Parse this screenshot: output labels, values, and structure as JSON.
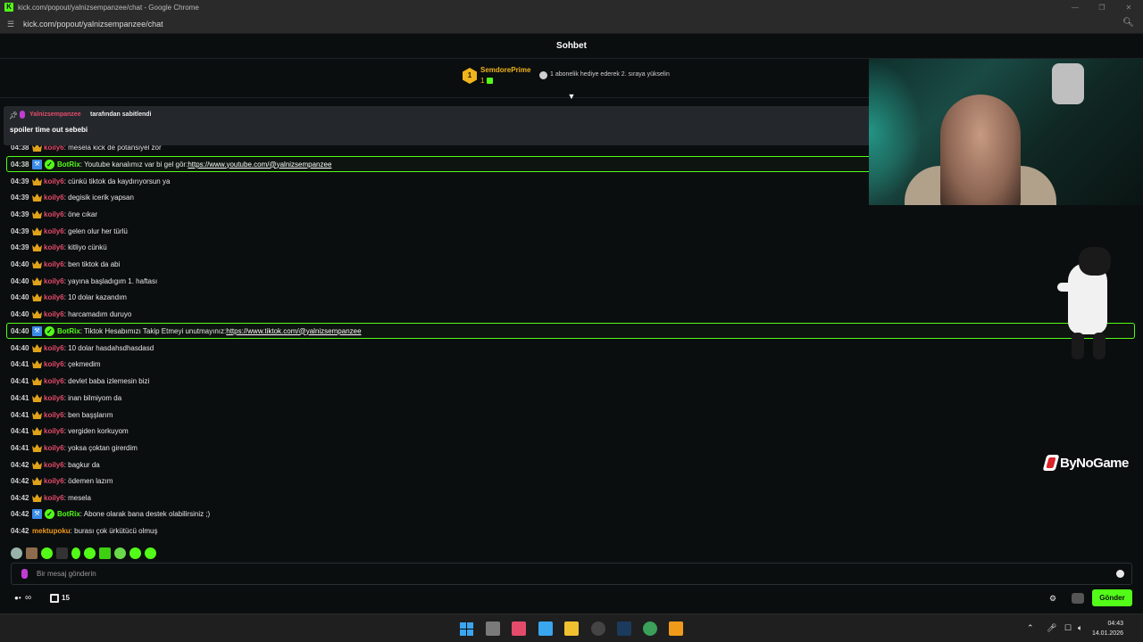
{
  "window": {
    "title": "kick.com/popout/yalnizsempanzee/chat - Google Chrome",
    "url": "kick.com/popout/yalnizsempanzee/chat",
    "favicon_letter": "K",
    "controls": [
      "minimize",
      "restore",
      "close"
    ]
  },
  "chat_header": {
    "title": "Sohbet"
  },
  "gift_bar": {
    "rank": "1",
    "top_gifter_name": "SemdorePrime",
    "top_gifter_count": "1",
    "hint": "1 abonelik hediye ederek 2. sıraya yükselin"
  },
  "pinned": {
    "pinned_by_user": "Yalnizsempanzee",
    "pinned_by_suffix": "tarafından sabitlendi",
    "text": "spoiler time out sebebi"
  },
  "messages": [
    {
      "time": "04:38",
      "user": "koily6",
      "text": ": mesela kick de potansiyel zor",
      "type": "koily"
    },
    {
      "time": "04:38",
      "user": "BotRix",
      "text": ": Youtube kanalımız var bi gel gör: ",
      "link": "https://www.youtube.com/@yalnizsempanzee",
      "type": "bot"
    },
    {
      "time": "04:39",
      "user": "koily6",
      "text": ": cünkü tiktok da kaydırıyorsun ya",
      "type": "koily"
    },
    {
      "time": "04:39",
      "user": "koily6",
      "text": ": degisik icerik yapsan",
      "type": "koily"
    },
    {
      "time": "04:39",
      "user": "koily6",
      "text": ": öne cıkar",
      "type": "koily"
    },
    {
      "time": "04:39",
      "user": "koily6",
      "text": ": gelen olur her türlü",
      "type": "koily"
    },
    {
      "time": "04:39",
      "user": "koily6",
      "text": ": kitliyo cünkü",
      "type": "koily"
    },
    {
      "time": "04:40",
      "user": "koily6",
      "text": ": ben tiktok da abi",
      "type": "koily"
    },
    {
      "time": "04:40",
      "user": "koily6",
      "text": ": yayına başladıgım 1. haftası",
      "type": "koily"
    },
    {
      "time": "04:40",
      "user": "koily6",
      "text": ": 10 dolar kazandım",
      "type": "koily"
    },
    {
      "time": "04:40",
      "user": "koily6",
      "text": ": harcamadım duruyo",
      "type": "koily"
    },
    {
      "time": "04:40",
      "user": "BotRix",
      "text": ": Tiktok Hesabımızı Takip Etmeyi unutmayınız: ",
      "link": "https://www.tiktok.com/@yalnizsempanzee",
      "type": "bot"
    },
    {
      "time": "04:40",
      "user": "koily6",
      "text": ": 10 dolar hasdahsdhasdasd",
      "type": "koily"
    },
    {
      "time": "04:41",
      "user": "koily6",
      "text": ": çekmedim",
      "type": "koily"
    },
    {
      "time": "04:41",
      "user": "koily6",
      "text": ": devlet baba izlemesin bizi",
      "type": "koily"
    },
    {
      "time": "04:41",
      "user": "koily6",
      "text": ": inan bilmiyom da",
      "type": "koily"
    },
    {
      "time": "04:41",
      "user": "koily6",
      "text": ": ben başşlarım",
      "type": "koily"
    },
    {
      "time": "04:41",
      "user": "koily6",
      "text": ": vergiden korkuyom",
      "type": "koily"
    },
    {
      "time": "04:41",
      "user": "koily6",
      "text": ": yoksa çoktan girerdim",
      "type": "koily"
    },
    {
      "time": "04:42",
      "user": "koily6",
      "text": ": bagkur da",
      "type": "koily"
    },
    {
      "time": "04:42",
      "user": "koily6",
      "text": ": ödemen lazım",
      "type": "koily"
    },
    {
      "time": "04:42",
      "user": "koily6",
      "text": ": mesela",
      "type": "koily"
    },
    {
      "time": "04:42",
      "user": "BotRix",
      "text": ": Abone olarak bana destek olabilirsiniz ;)",
      "type": "bot-plain"
    },
    {
      "time": "04:42",
      "user": "mektupoku",
      "text": ": burası çok ürkütücü olmuş",
      "type": "mektup"
    }
  ],
  "watermark": {
    "text": "ByNoGame"
  },
  "input": {
    "placeholder": "Bir mesaj gönderin",
    "value": ""
  },
  "toolbar": {
    "points_value": "∞",
    "box_value": "15",
    "send_label": "Gönder"
  },
  "taskbar": {
    "time": "04:43",
    "date": "14.01.2026",
    "apps": [
      "start",
      "task-view",
      "snipping-tool",
      "photos",
      "file-explorer",
      "obs",
      "steam",
      "chrome",
      "streamer-app"
    ]
  },
  "colors": {
    "accent": "#53fc18",
    "user_koily": "#e44b6b",
    "user_mektup": "#f09a1a",
    "background": "#0b0e0f"
  }
}
